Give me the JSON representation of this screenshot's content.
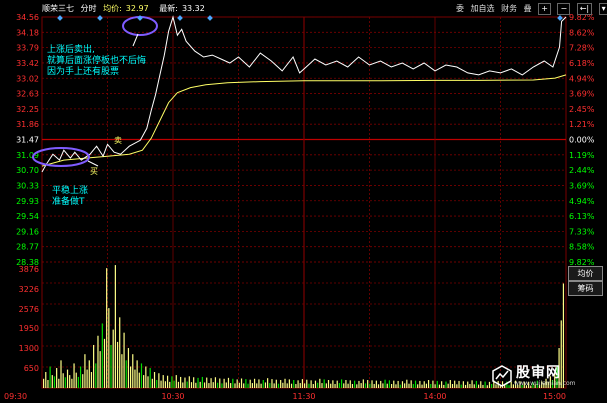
{
  "header": {
    "stock_name": "顺荣三七",
    "view": "分时",
    "avg_label": "均价:",
    "avg_value": "32.97",
    "last_label": "最新:",
    "last_value": "33.32"
  },
  "controls": {
    "entrust": "委",
    "add_watch": "加自选",
    "finance": "财务",
    "stack": "叠",
    "zoom_in": "+",
    "zoom_out": "−",
    "prev": "←|",
    "dropdown": "▾"
  },
  "side_buttons": {
    "avg_price": "均价",
    "chips": "筹码"
  },
  "price_axis_left": [
    "34.56",
    "34.18",
    "33.79",
    "33.42",
    "33.02",
    "32.63",
    "32.25",
    "31.86",
    "31.47",
    "31.09",
    "30.70",
    "30.33",
    "29.93",
    "29.54",
    "29.16",
    "28.77",
    "28.38"
  ],
  "pct_axis_right": [
    "9.82%",
    "8.62%",
    "7.28%",
    "6.18%",
    "4.94%",
    "3.69%",
    "2.45%",
    "1.21%",
    "0.00%",
    "1.19%",
    "2.44%",
    "3.69%",
    "4.94%",
    "6.13%",
    "7.33%",
    "8.58%",
    "9.82%"
  ],
  "volume_axis_left": [
    "3876",
    "3226",
    "2576",
    "1950",
    "1300",
    "650"
  ],
  "time_axis": [
    "09:30",
    "10:30",
    "11:30",
    "14:00",
    "15:00"
  ],
  "annotations": {
    "note_top": [
      "上涨后卖出,",
      "就算后面涨停板也不后悔",
      "因为手上还有股票"
    ],
    "note_bottom": [
      "平稳上涨",
      "准备做T"
    ],
    "buy_mark": "买",
    "sell_mark": "卖"
  },
  "colors": {
    "up": "#ff3030",
    "down": "#00ff00",
    "price_line": "#ffffff",
    "avg_line": "#ffff66",
    "grid": "#7a0000",
    "note": "#00ffff",
    "circle": "#7f5cff",
    "volume": "#ffff88"
  },
  "watermark": {
    "title": "股审网",
    "url": "www.wujiemian.com"
  },
  "chart_data": {
    "type": "line",
    "prev_close": 31.47,
    "ylim": [
      28.38,
      34.56
    ],
    "x_ticks": [
      "09:30",
      "10:30",
      "11:30",
      "14:00",
      "15:00"
    ],
    "series": [
      {
        "points": [
          [
            0,
            30.65
          ],
          [
            2,
            30.85
          ],
          [
            5,
            31.1
          ],
          [
            8,
            30.95
          ],
          [
            10,
            31.2
          ],
          [
            13,
            31.0
          ],
          [
            15,
            31.15
          ],
          [
            18,
            30.95
          ],
          [
            22,
            31.1
          ],
          [
            25,
            31.3
          ],
          [
            28,
            31.05
          ],
          [
            30,
            31.35
          ],
          [
            33,
            31.15
          ],
          [
            36,
            31.1
          ],
          [
            40,
            31.3
          ],
          [
            45,
            31.45
          ],
          [
            48,
            31.75
          ],
          [
            50,
            32.2
          ],
          [
            52,
            32.6
          ],
          [
            54,
            33.1
          ],
          [
            56,
            33.6
          ],
          [
            58,
            34.2
          ],
          [
            60,
            34.56
          ],
          [
            62,
            34.1
          ],
          [
            64,
            34.25
          ],
          [
            66,
            33.95
          ],
          [
            70,
            33.7
          ],
          [
            74,
            33.55
          ],
          [
            78,
            33.6
          ],
          [
            82,
            33.5
          ],
          [
            86,
            33.4
          ],
          [
            90,
            33.55
          ],
          [
            95,
            33.3
          ],
          [
            100,
            33.65
          ],
          [
            105,
            33.45
          ],
          [
            110,
            33.2
          ],
          [
            115,
            33.55
          ],
          [
            118,
            33.15
          ],
          [
            121,
            33.3
          ],
          [
            125,
            33.5
          ],
          [
            130,
            33.35
          ],
          [
            135,
            33.45
          ],
          [
            140,
            33.3
          ],
          [
            145,
            33.55
          ],
          [
            150,
            33.35
          ],
          [
            155,
            33.45
          ],
          [
            160,
            33.3
          ],
          [
            165,
            33.4
          ],
          [
            170,
            33.25
          ],
          [
            175,
            33.4
          ],
          [
            180,
            33.2
          ],
          [
            185,
            33.35
          ],
          [
            190,
            33.3
          ],
          [
            195,
            33.15
          ],
          [
            200,
            33.1
          ],
          [
            205,
            33.2
          ],
          [
            210,
            33.15
          ],
          [
            215,
            33.25
          ],
          [
            220,
            33.1
          ],
          [
            225,
            33.3
          ],
          [
            230,
            33.45
          ],
          [
            234,
            33.3
          ],
          [
            237,
            33.8
          ],
          [
            238,
            34.45
          ],
          [
            240,
            34.56
          ]
        ]
      },
      {
        "points": [
          [
            0,
            30.8
          ],
          [
            10,
            30.95
          ],
          [
            20,
            31.0
          ],
          [
            30,
            31.05
          ],
          [
            40,
            31.1
          ],
          [
            46,
            31.2
          ],
          [
            50,
            31.5
          ],
          [
            54,
            31.95
          ],
          [
            58,
            32.4
          ],
          [
            62,
            32.65
          ],
          [
            68,
            32.78
          ],
          [
            75,
            32.85
          ],
          [
            85,
            32.9
          ],
          [
            100,
            32.93
          ],
          [
            120,
            32.95
          ],
          [
            150,
            32.95
          ],
          [
            180,
            32.96
          ],
          [
            200,
            32.96
          ],
          [
            225,
            32.97
          ],
          [
            235,
            33.02
          ],
          [
            240,
            33.1
          ]
        ]
      }
    ],
    "volume": {
      "ylim": [
        0,
        4100
      ],
      "values": [
        300,
        520,
        260,
        700,
        420,
        380,
        650,
        300,
        900,
        480,
        350,
        600,
        420,
        300,
        800,
        500,
        360,
        700,
        450,
        1100,
        600,
        900,
        520,
        1400,
        800,
        1700,
        1200,
        2100,
        1600,
        3900,
        2600,
        1400,
        1900,
        4000,
        1500,
        2300,
        1100,
        1800,
        900,
        1300,
        700,
        1100,
        600,
        900,
        500,
        800,
        420,
        700,
        380,
        650,
        300,
        520,
        260,
        480,
        240,
        420,
        220,
        400,
        200,
        380,
        240,
        420,
        200,
        360,
        180,
        340,
        210,
        380,
        190,
        350,
        170,
        330,
        200,
        360,
        180,
        340,
        160,
        320,
        190,
        350,
        170,
        310,
        150,
        300,
        180,
        330,
        160,
        300,
        150,
        280,
        170,
        310,
        150,
        290,
        140,
        270,
        160,
        300,
        150,
        280,
        140,
        260,
        180,
        320,
        160,
        290,
        150,
        270,
        140,
        260,
        170,
        300,
        150,
        280,
        140,
        260,
        130,
        250,
        160,
        290,
        150,
        270,
        140,
        250,
        130,
        240,
        170,
        300,
        160,
        280,
        150,
        260,
        140,
        250,
        130,
        240,
        160,
        280,
        150,
        260,
        140,
        250,
        130,
        240,
        120,
        230,
        160,
        280,
        150,
        260,
        140,
        250,
        130,
        240,
        120,
        230,
        150,
        270,
        140,
        250,
        130,
        240,
        120,
        230,
        110,
        220,
        150,
        270,
        140,
        250,
        130,
        240,
        120,
        230,
        110,
        220,
        140,
        260,
        130,
        240,
        120,
        230,
        110,
        220,
        100,
        210,
        140,
        260,
        130,
        240,
        120,
        230,
        110,
        220,
        100,
        210,
        130,
        250,
        120,
        230,
        110,
        220,
        100,
        210,
        90,
        200,
        130,
        250,
        120,
        230,
        110,
        220,
        100,
        210,
        90,
        200,
        120,
        240,
        110,
        220,
        100,
        210,
        90,
        200,
        80,
        190,
        120,
        240,
        110,
        220,
        160,
        300,
        200,
        380,
        260,
        500,
        700,
        1300,
        2200,
        3400
      ]
    }
  }
}
